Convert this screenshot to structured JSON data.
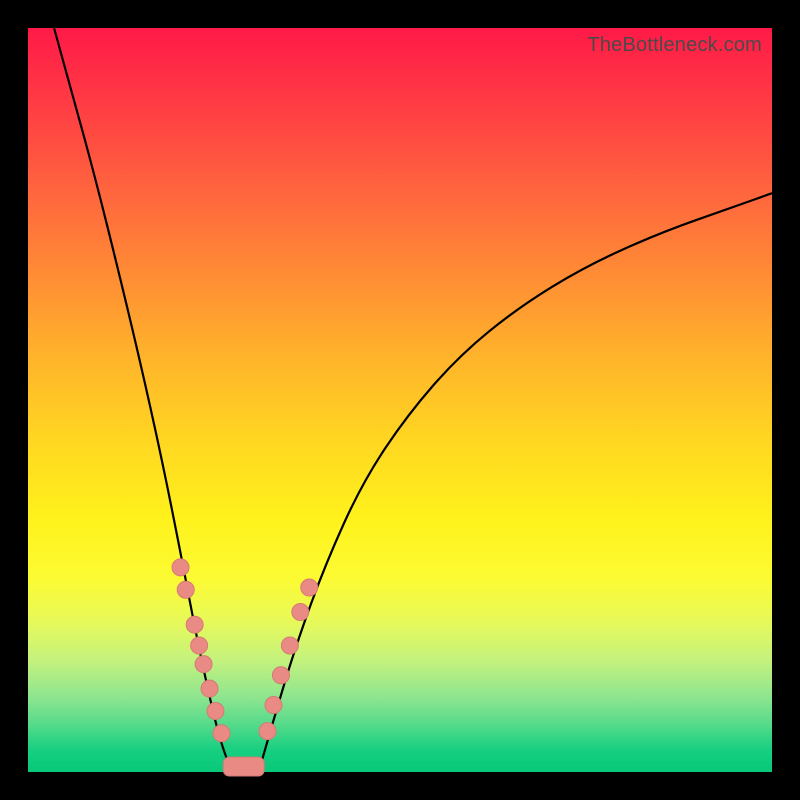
{
  "watermark": "TheBottleneck.com",
  "chart_data": {
    "type": "line",
    "title": "",
    "xlabel": "",
    "ylabel": "",
    "xlim": [
      0,
      1
    ],
    "ylim": [
      0,
      1
    ],
    "series": [
      {
        "name": "left-curve",
        "x": [
          0.035,
          0.06,
          0.09,
          0.12,
          0.15,
          0.18,
          0.205,
          0.225,
          0.242,
          0.255,
          0.266,
          0.275
        ],
        "y": [
          1.0,
          0.91,
          0.8,
          0.68,
          0.555,
          0.42,
          0.295,
          0.19,
          0.11,
          0.055,
          0.02,
          0.0
        ]
      },
      {
        "name": "right-curve",
        "x": [
          0.31,
          0.33,
          0.36,
          0.4,
          0.45,
          0.51,
          0.58,
          0.66,
          0.75,
          0.85,
          0.95,
          1.0
        ],
        "y": [
          0.0,
          0.07,
          0.17,
          0.28,
          0.39,
          0.48,
          0.56,
          0.625,
          0.68,
          0.725,
          0.76,
          0.778
        ]
      }
    ],
    "marker_clusters": [
      {
        "name": "left-dot-cluster",
        "points": [
          {
            "x": 0.205,
            "y": 0.275
          },
          {
            "x": 0.212,
            "y": 0.245
          },
          {
            "x": 0.224,
            "y": 0.198
          },
          {
            "x": 0.23,
            "y": 0.17
          },
          {
            "x": 0.236,
            "y": 0.145
          },
          {
            "x": 0.244,
            "y": 0.112
          },
          {
            "x": 0.252,
            "y": 0.082
          },
          {
            "x": 0.26,
            "y": 0.052
          }
        ]
      },
      {
        "name": "right-dot-cluster",
        "points": [
          {
            "x": 0.322,
            "y": 0.055
          },
          {
            "x": 0.33,
            "y": 0.09
          },
          {
            "x": 0.34,
            "y": 0.13
          },
          {
            "x": 0.352,
            "y": 0.17
          },
          {
            "x": 0.366,
            "y": 0.215
          },
          {
            "x": 0.378,
            "y": 0.248
          }
        ]
      }
    ],
    "bottom_pill": {
      "x_center": 0.29,
      "y": 0.01,
      "width": 0.055,
      "height": 0.02
    }
  },
  "colors": {
    "dot": "#e98b84",
    "curve": "#000000"
  }
}
